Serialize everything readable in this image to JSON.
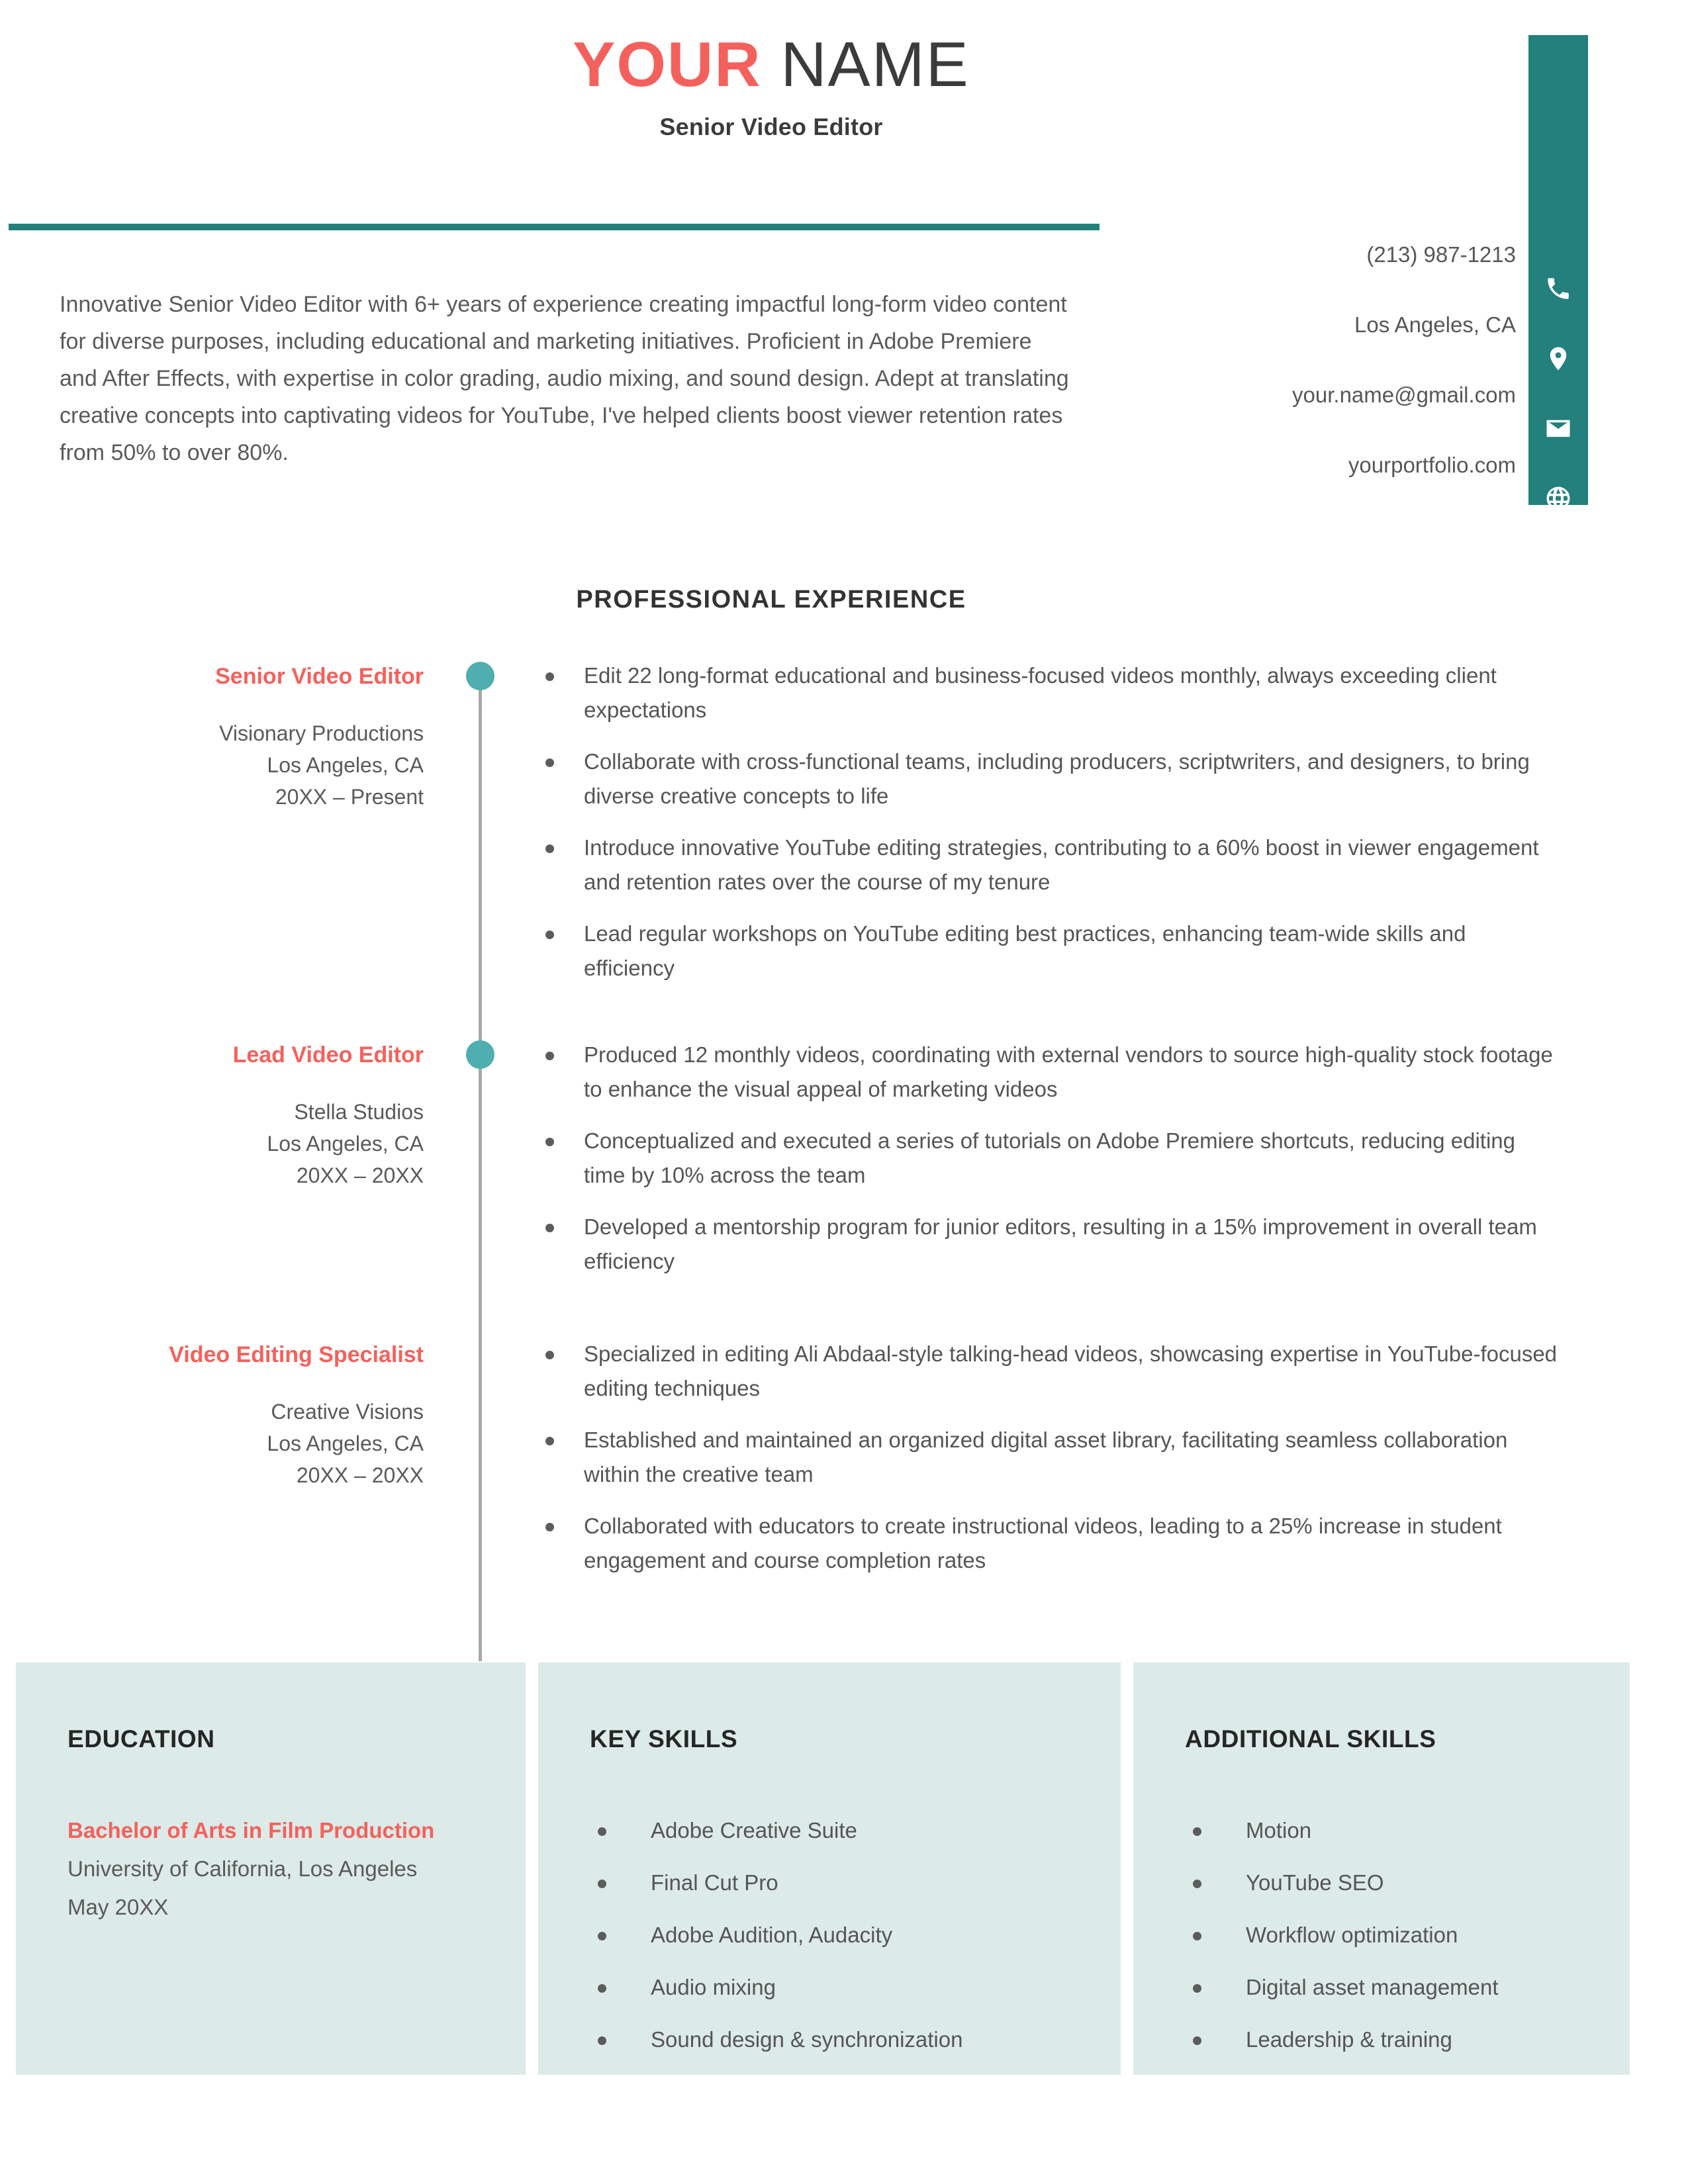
{
  "header": {
    "name_first": "YOUR",
    "name_last": " NAME",
    "job_title": "Senior Video Editor",
    "accent_coral": "#F4615C",
    "accent_teal": "#23807C",
    "dot_teal": "#4FAEAF",
    "mint_bg": "#DCEAE8"
  },
  "contact": {
    "phone": "(213) 987-1213",
    "location": "Los Angeles, CA",
    "email": "your.name@gmail.com",
    "website": "yourportfolio.com",
    "icons": [
      "phone-icon",
      "location-pin-icon",
      "envelope-icon",
      "globe-icon"
    ]
  },
  "summary": {
    "text": "Innovative Senior Video Editor with 6+ years of experience creating impactful long-form video content for diverse purposes, including educational and marketing initiatives. Proficient in Adobe Premiere and After Effects, with expertise in color grading, audio mixing, and sound design. Adept at translating creative concepts into captivating videos for YouTube, I've helped clients boost viewer retention rates from 50% to over 80%."
  },
  "experience": {
    "heading": "PROFESSIONAL EXPERIENCE",
    "entries": [
      {
        "title": "Senior Video Editor",
        "company": "Visionary Productions",
        "location": "Los Angeles, CA",
        "dates": "20XX – Present",
        "bullets": [
          "Edit 22 long-format educational and business-focused videos monthly, always exceeding client expectations",
          "Collaborate with cross-functional teams, including producers, scriptwriters, and designers, to bring diverse creative concepts to life",
          "Introduce innovative YouTube editing strategies, contributing to a 60% boost in viewer engagement and retention rates over the course of my tenure",
          "Lead regular workshops on YouTube editing best practices, enhancing team-wide skills and efficiency"
        ]
      },
      {
        "title": "Lead Video Editor",
        "company": "Stella Studios",
        "location": "Los Angeles, CA",
        "dates": "20XX – 20XX",
        "bullets": [
          "Produced 12 monthly videos, coordinating with external vendors to source high-quality stock footage to enhance the visual appeal of marketing videos",
          "Conceptualized and executed a series of tutorials on Adobe Premiere shortcuts, reducing editing time by 10% across the team",
          "Developed a mentorship program for junior editors, resulting in a 15% improvement in overall team efficiency"
        ]
      },
      {
        "title": "Video Editing Specialist",
        "company": "Creative Visions",
        "location": "Los Angeles, CA",
        "dates": "20XX – 20XX",
        "bullets": [
          "Specialized in editing Ali Abdaal-style talking-head videos, showcasing expertise in YouTube-focused editing techniques",
          "Established and maintained an organized digital asset library, facilitating seamless collaboration within the creative team",
          "Collaborated with educators to create instructional videos, leading to a 25% increase in student engagement and course completion rates"
        ]
      }
    ]
  },
  "education": {
    "heading": "EDUCATION",
    "degree": "Bachelor of Arts in Film Production",
    "school": "University of California, Los Angeles",
    "date": "May 20XX"
  },
  "key_skills": {
    "heading": "KEY SKILLS",
    "items": [
      "Adobe Creative Suite",
      "Final Cut Pro",
      "Adobe Audition, Audacity",
      "Audio mixing",
      "Sound design & synchronization"
    ]
  },
  "additional_skills": {
    "heading": "ADDITIONAL SKILLS",
    "items": [
      "Motion",
      "YouTube SEO",
      "Workflow optimization",
      "Digital asset management",
      "Leadership & training"
    ]
  }
}
